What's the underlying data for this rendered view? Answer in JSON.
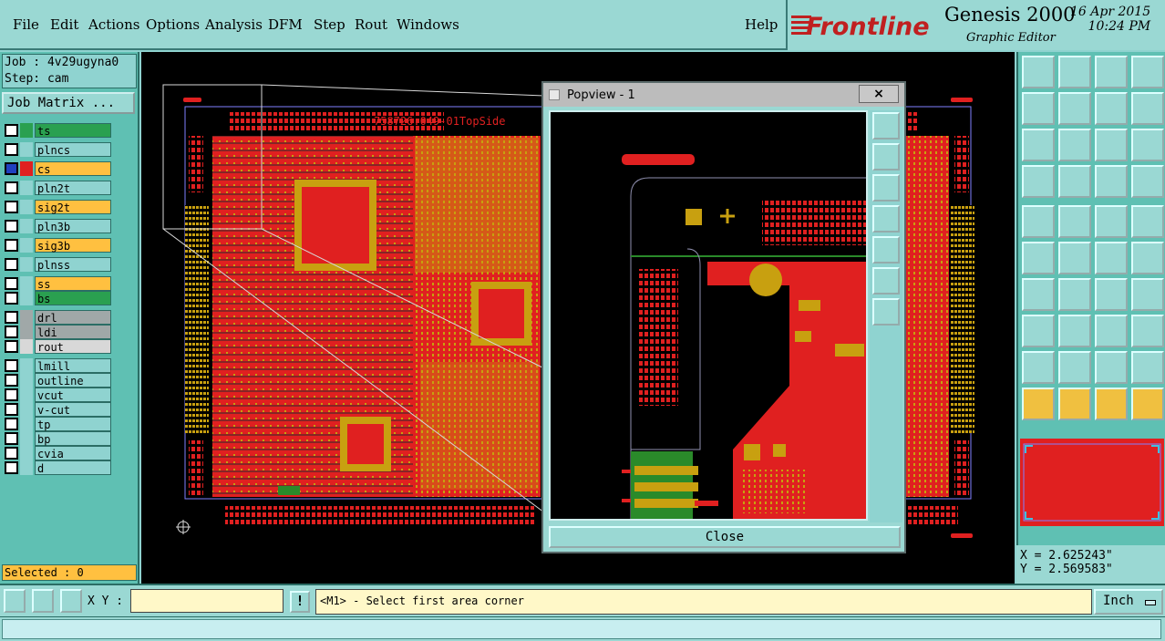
{
  "menu": [
    "File",
    "Edit",
    "Actions",
    "Options",
    "Analysis",
    "DFM",
    "Step",
    "Rout",
    "Windows",
    "Help"
  ],
  "brand": {
    "logo": "Frontline",
    "product": "Genesis 2000",
    "subtitle": "Graphic Editor",
    "date": "16 Apr 2015",
    "time": "10:24 PM"
  },
  "job": {
    "job_label": "Job : 4v29ugyna0",
    "step_label": "Step: cam",
    "matrix_button": "Job Matrix ..."
  },
  "layers": [
    {
      "name": "ts",
      "color": "#2aa050",
      "swatch": "#2aa050"
    },
    {
      "name": "plncs",
      "color": "#8fd3d0",
      "swatch": "#8fd3d0"
    },
    {
      "name": "cs",
      "color": "#ffc040",
      "swatch": "#e02020",
      "active": true
    },
    {
      "name": "pln2t",
      "color": "#8fd3d0",
      "swatch": "#8fd3d0"
    },
    {
      "name": "sig2t",
      "color": "#ffc040",
      "swatch": "#8fd3d0"
    },
    {
      "name": "pln3b",
      "color": "#8fd3d0",
      "swatch": "#8fd3d0"
    },
    {
      "name": "sig3b",
      "color": "#ffc040",
      "swatch": "#8fd3d0"
    },
    {
      "name": "plnss",
      "color": "#8fd3d0",
      "swatch": "#8fd3d0"
    },
    {
      "name": "ss",
      "color": "#ffc040",
      "swatch": "#8fd3d0"
    },
    {
      "name": "bs",
      "color": "#2aa050",
      "swatch": "#8fd3d0"
    },
    {
      "name": "drl",
      "color": "#a0a8a8",
      "swatch": "#a0a8a8"
    },
    {
      "name": "ldi",
      "color": "#a0a8a8",
      "swatch": "#a0a8a8"
    },
    {
      "name": "rout",
      "color": "#d8d8d8",
      "swatch": "#d8d8d8"
    },
    {
      "name": "lmill",
      "color": "#8fd3d0",
      "swatch": "#8fd3d0"
    },
    {
      "name": "outline",
      "color": "#8fd3d0",
      "swatch": "#8fd3d0"
    },
    {
      "name": "vcut",
      "color": "#8fd3d0",
      "swatch": "#8fd3d0"
    },
    {
      "name": "v-cut",
      "color": "#8fd3d0",
      "swatch": "#8fd3d0"
    },
    {
      "name": "tp",
      "color": "#8fd3d0",
      "swatch": "#8fd3d0"
    },
    {
      "name": "bp",
      "color": "#8fd3d0",
      "swatch": "#8fd3d0"
    },
    {
      "name": "cvia",
      "color": "#8fd3d0",
      "swatch": "#8fd3d0"
    },
    {
      "name": "d",
      "color": "#8fd3d0",
      "swatch": "#8fd3d0"
    }
  ],
  "selected": "Selected : 0",
  "board_label": "758726.049-01TopSide",
  "popview": {
    "title": "Popview - 1",
    "close_x": "×",
    "close_button": "Close"
  },
  "coords": {
    "x": "X = 2.625243\"",
    "y": "Y = 2.569583\""
  },
  "bottom": {
    "xy_label": "X Y :",
    "input_value": "",
    "bang": "!",
    "prompt": "<M1> - Select first area corner",
    "unit": "Inch"
  },
  "colors": {
    "copper": "#e02020",
    "pad": "#c8a010",
    "bg": "#000000",
    "panel": "#8fd3d0",
    "trace_green": "#2a8a2a"
  }
}
